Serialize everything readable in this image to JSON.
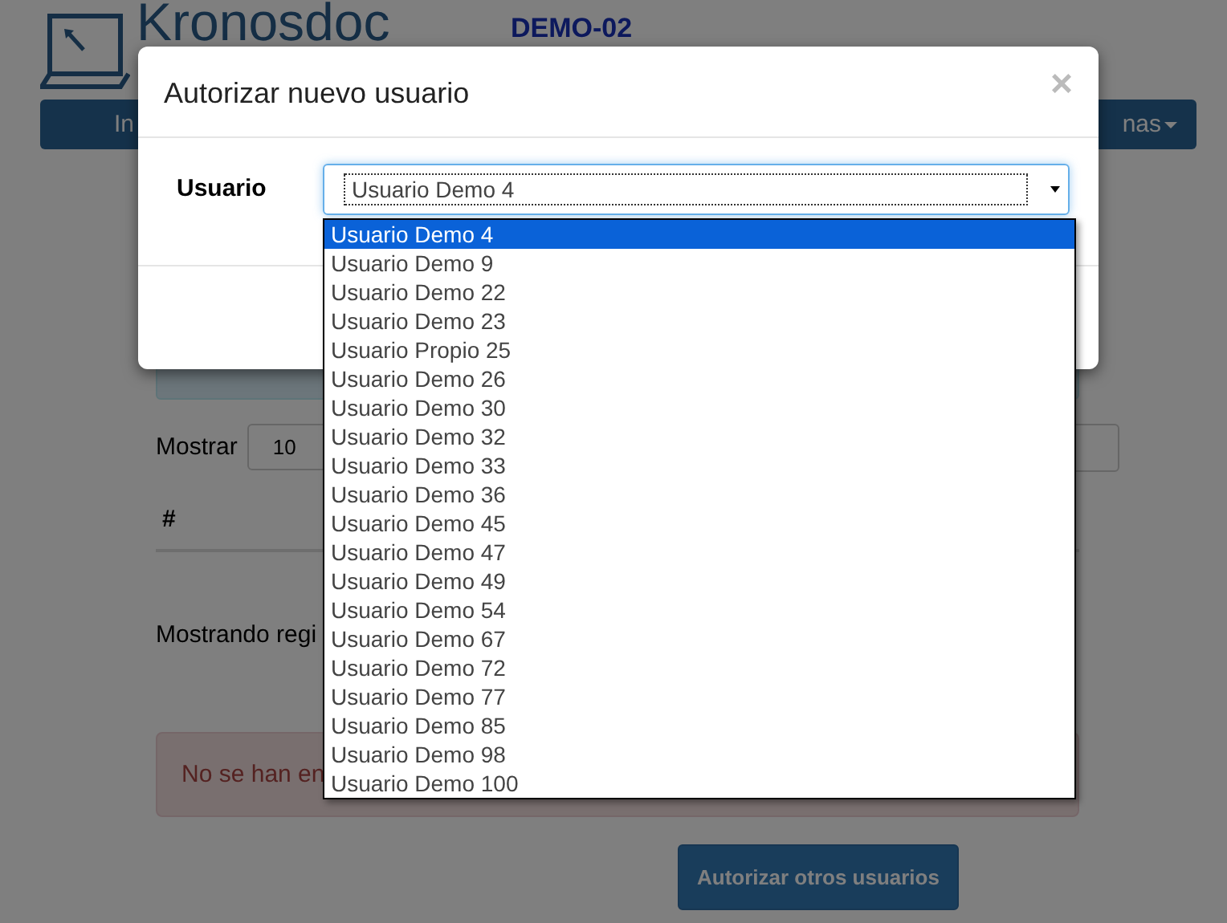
{
  "logo": {
    "name": "Kronosdoc"
  },
  "environment": "DEMO-02",
  "nav": {
    "left_item": "In",
    "right_item": "nas"
  },
  "length_control": {
    "label": "Mostrar",
    "value": "10"
  },
  "table": {
    "columns": [
      "#"
    ]
  },
  "info": "Mostrando regi",
  "alert": "No se han en",
  "authorize_button": "Autorizar otros usuarios",
  "modal": {
    "title": "Autorizar nuevo usuario",
    "close": "×",
    "field_label": "Usuario",
    "select_value": "Usuario Demo 4",
    "options": [
      {
        "label": "Usuario Demo 4",
        "selected": true
      },
      {
        "label": "Usuario Demo 9",
        "selected": false
      },
      {
        "label": "Usuario Demo 22",
        "selected": false
      },
      {
        "label": "Usuario Demo 23",
        "selected": false
      },
      {
        "label": "Usuario Propio 25",
        "selected": false
      },
      {
        "label": "Usuario Demo 26",
        "selected": false
      },
      {
        "label": "Usuario Demo 30",
        "selected": false
      },
      {
        "label": "Usuario Demo 32",
        "selected": false
      },
      {
        "label": "Usuario Demo 33",
        "selected": false
      },
      {
        "label": "Usuario Demo 36",
        "selected": false
      },
      {
        "label": "Usuario Demo 45",
        "selected": false
      },
      {
        "label": "Usuario Demo 47",
        "selected": false
      },
      {
        "label": "Usuario Demo 49",
        "selected": false
      },
      {
        "label": "Usuario Demo 54",
        "selected": false
      },
      {
        "label": "Usuario Demo 67",
        "selected": false
      },
      {
        "label": "Usuario Demo 72",
        "selected": false
      },
      {
        "label": "Usuario Demo 77",
        "selected": false
      },
      {
        "label": "Usuario Demo 85",
        "selected": false
      },
      {
        "label": "Usuario Demo 98",
        "selected": false
      },
      {
        "label": "Usuario Demo 100",
        "selected": false
      }
    ]
  }
}
